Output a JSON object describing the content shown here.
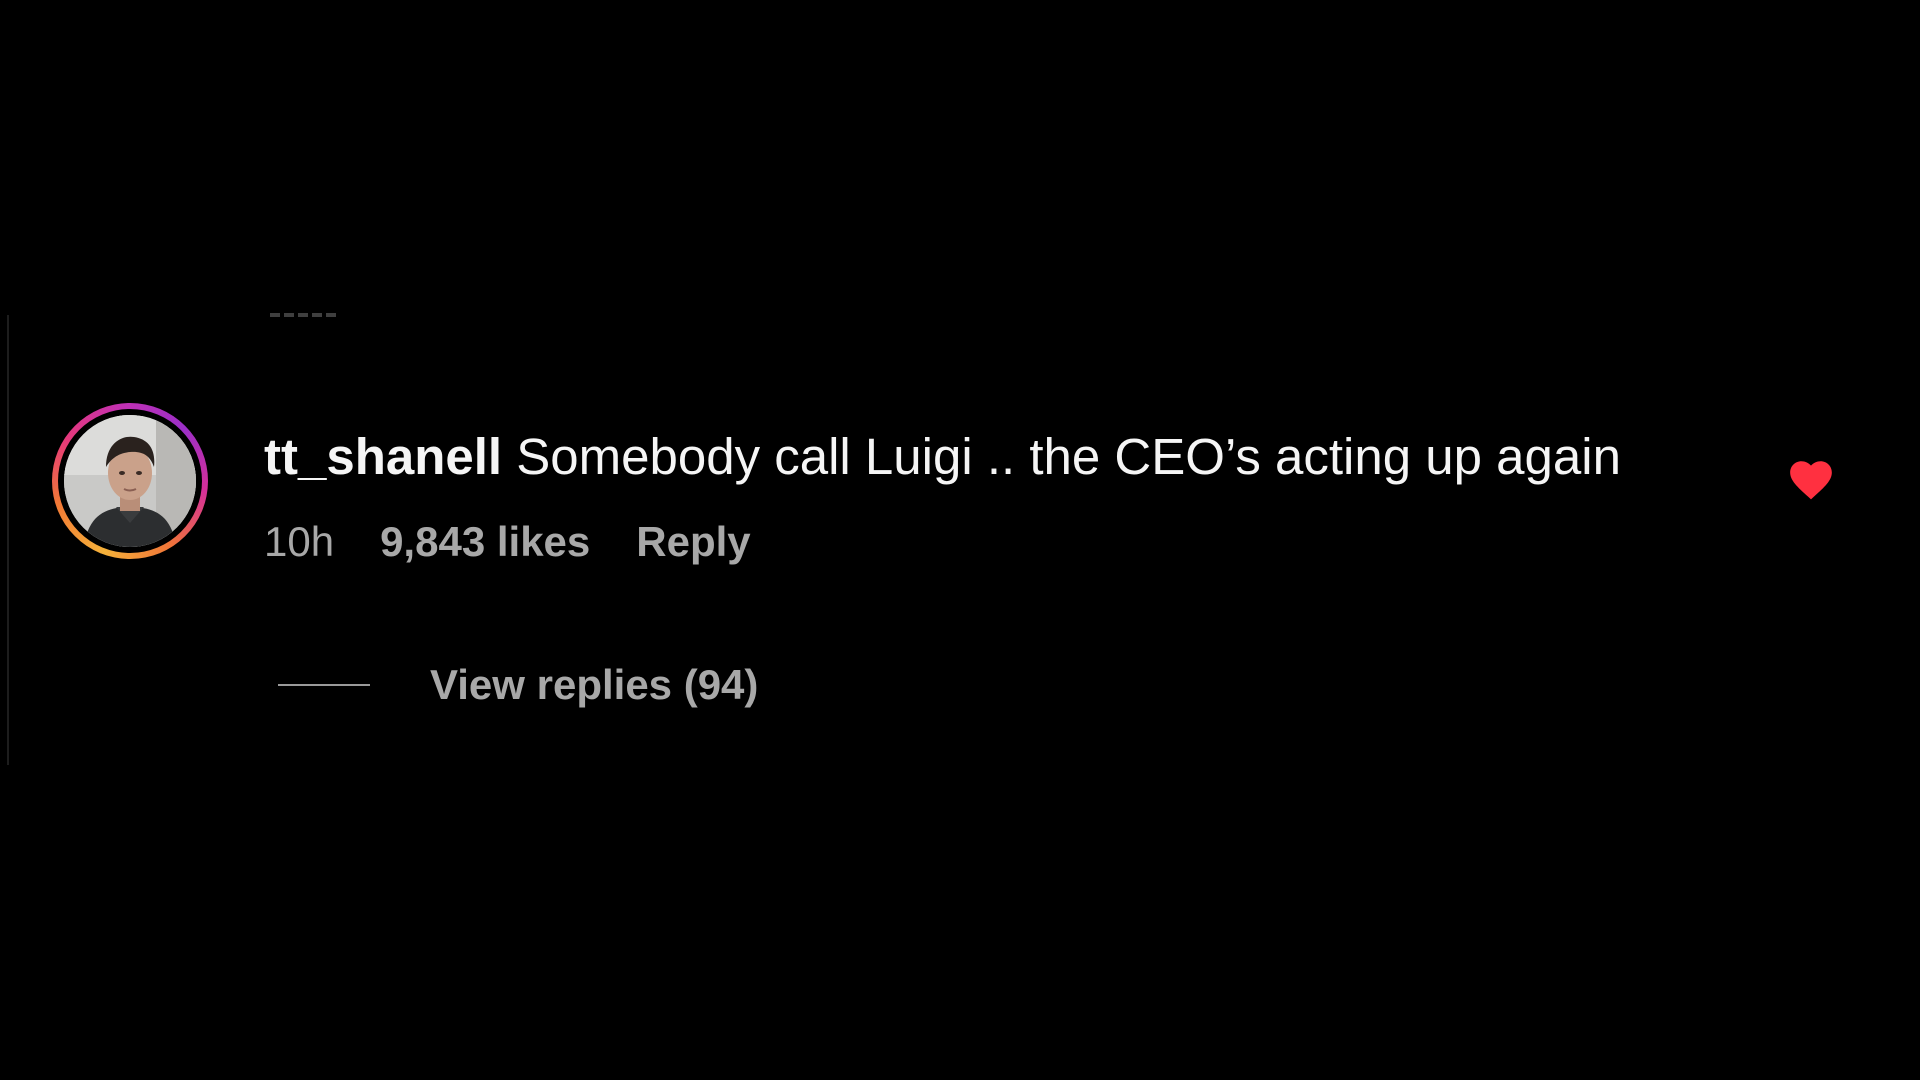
{
  "comment": {
    "username": "tt_shanell",
    "text": "Somebody call Luigi .. the CEO’s acting up again",
    "time": "10h",
    "likes": "9,843 likes",
    "reply_label": "Reply",
    "view_replies": "View replies (94)",
    "liked": true
  },
  "colors": {
    "background": "#000000",
    "text_primary": "#f5f5f5",
    "text_secondary": "#a8a8a8",
    "heart": "#ff3040",
    "story_ring": [
      "#f5b13a",
      "#e6397a",
      "#9b2fc7"
    ]
  },
  "icons": {
    "like": "heart-filled-icon"
  }
}
